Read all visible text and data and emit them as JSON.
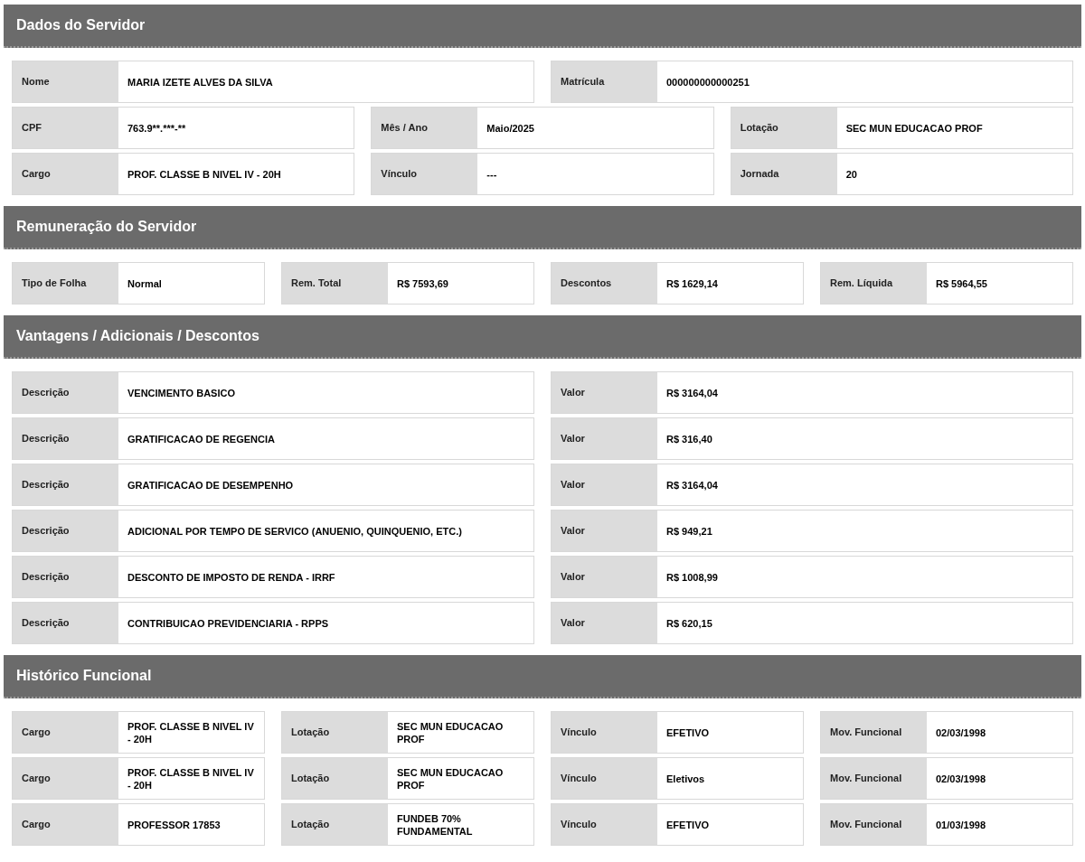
{
  "sections": [
    {
      "title": "Dados do Servidor",
      "rows": [
        {
          "fields": [
            {
              "label": "Nome",
              "value": "MARIA IZETE ALVES DA SILVA"
            },
            {
              "label": "Matrícula",
              "value": "000000000000251"
            }
          ]
        },
        {
          "fields": [
            {
              "label": "CPF",
              "value": "763.9**.***-**"
            },
            {
              "label": "Mês / Ano",
              "value": "Maio/2025"
            },
            {
              "label": "Lotação",
              "value": "SEC MUN EDUCACAO PROF"
            }
          ]
        },
        {
          "fields": [
            {
              "label": "Cargo",
              "value": "PROF. CLASSE B NIVEL IV - 20H"
            },
            {
              "label": "Vínculo",
              "value": "---"
            },
            {
              "label": "Jornada",
              "value": "20"
            }
          ]
        }
      ]
    },
    {
      "title": "Remuneração do Servidor",
      "rows": [
        {
          "fields": [
            {
              "label": "Tipo de Folha",
              "value": "Normal"
            },
            {
              "label": "Rem. Total",
              "value": "R$ 7593,69"
            },
            {
              "label": "Descontos",
              "value": "R$ 1629,14"
            },
            {
              "label": "Rem. Líquida",
              "value": "R$ 5964,55"
            }
          ]
        }
      ]
    },
    {
      "title": "Vantagens / Adicionais / Descontos",
      "rows": [
        {
          "fields": [
            {
              "label": "Descrição",
              "value": "VENCIMENTO BASICO"
            },
            {
              "label": "Valor",
              "value": "R$ 3164,04"
            }
          ]
        },
        {
          "fields": [
            {
              "label": "Descrição",
              "value": "GRATIFICACAO DE REGENCIA"
            },
            {
              "label": "Valor",
              "value": "R$ 316,40"
            }
          ]
        },
        {
          "fields": [
            {
              "label": "Descrição",
              "value": "GRATIFICACAO DE DESEMPENHO"
            },
            {
              "label": "Valor",
              "value": "R$ 3164,04"
            }
          ]
        },
        {
          "fields": [
            {
              "label": "Descrição",
              "value": "ADICIONAL POR TEMPO DE SERVICO (ANUENIO, QUINQUENIO, ETC.)"
            },
            {
              "label": "Valor",
              "value": "R$ 949,21"
            }
          ]
        },
        {
          "fields": [
            {
              "label": "Descrição",
              "value": "DESCONTO DE IMPOSTO DE RENDA - IRRF"
            },
            {
              "label": "Valor",
              "value": "R$ 1008,99"
            }
          ]
        },
        {
          "fields": [
            {
              "label": "Descrição",
              "value": "CONTRIBUICAO PREVIDENCIARIA - RPPS"
            },
            {
              "label": "Valor",
              "value": "R$ 620,15"
            }
          ]
        }
      ]
    },
    {
      "title": "Histórico Funcional",
      "rows": [
        {
          "fields": [
            {
              "label": "Cargo",
              "value": "PROF. CLASSE B NIVEL IV - 20H"
            },
            {
              "label": "Lotação",
              "value": "SEC MUN EDUCACAO PROF"
            },
            {
              "label": "Vínculo",
              "value": "EFETIVO"
            },
            {
              "label": "Mov. Funcional",
              "value": "02/03/1998"
            }
          ]
        },
        {
          "fields": [
            {
              "label": "Cargo",
              "value": "PROF. CLASSE B NIVEL IV - 20H"
            },
            {
              "label": "Lotação",
              "value": "SEC MUN EDUCACAO PROF"
            },
            {
              "label": "Vínculo",
              "value": "Eletivos"
            },
            {
              "label": "Mov. Funcional",
              "value": "02/03/1998"
            }
          ]
        },
        {
          "fields": [
            {
              "label": "Cargo",
              "value": "PROFESSOR 17853"
            },
            {
              "label": "Lotação",
              "value": "FUNDEB 70% FUNDAMENTAL"
            },
            {
              "label": "Vínculo",
              "value": "EFETIVO"
            },
            {
              "label": "Mov. Funcional",
              "value": "01/03/1998"
            }
          ]
        }
      ]
    }
  ]
}
